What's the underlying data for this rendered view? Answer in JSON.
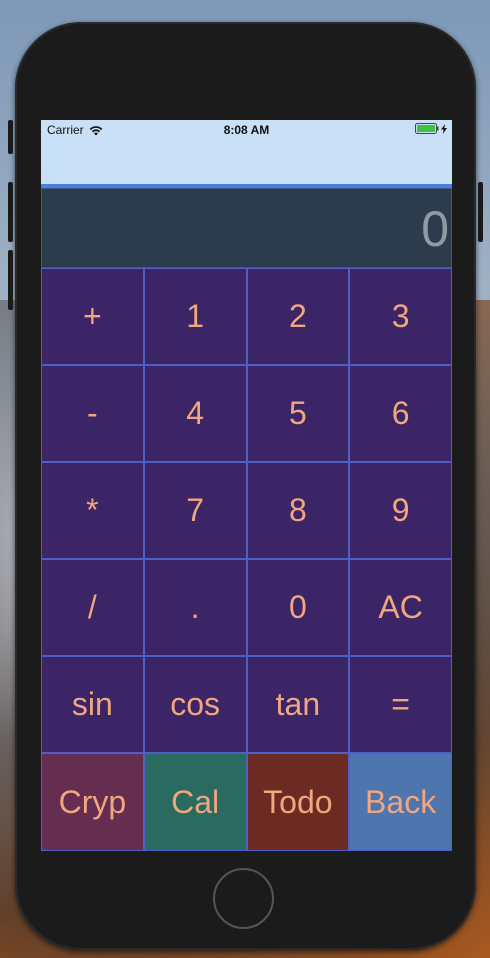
{
  "status_bar": {
    "carrier": "Carrier",
    "time": "8:08 AM"
  },
  "display": {
    "value": "0"
  },
  "keys": [
    {
      "label": "+"
    },
    {
      "label": "1"
    },
    {
      "label": "2"
    },
    {
      "label": "3"
    },
    {
      "label": "-"
    },
    {
      "label": "4"
    },
    {
      "label": "5"
    },
    {
      "label": "6"
    },
    {
      "label": "*"
    },
    {
      "label": "7"
    },
    {
      "label": "8"
    },
    {
      "label": "9"
    },
    {
      "label": "/"
    },
    {
      "label": "."
    },
    {
      "label": "0"
    },
    {
      "label": "AC"
    },
    {
      "label": "sin"
    },
    {
      "label": "cos"
    },
    {
      "label": "tan"
    },
    {
      "label": "="
    }
  ],
  "bottom_nav": [
    {
      "label": "Cryp",
      "color": "#652d4f"
    },
    {
      "label": "Cal",
      "color": "#2a6b5f"
    },
    {
      "label": "Todo",
      "color": "#6b2b22"
    },
    {
      "label": "Back",
      "color": "#4e75ad"
    }
  ],
  "colors": {
    "key_background": "#3b2566",
    "key_text": "#f0a67e",
    "key_border": "#4f5fc6",
    "display_background": "#2c3c4c",
    "accent": "#4a7fe0",
    "nav_bar": "#c9e0f6"
  }
}
